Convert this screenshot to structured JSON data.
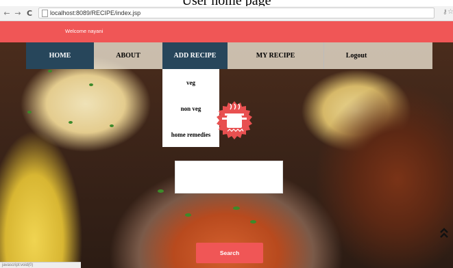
{
  "caption": "User home page",
  "browser": {
    "url": "localhost:8089/RECIPE/index.jsp",
    "status_text": "javascript:void(0)"
  },
  "welcome_text": "Welcome nayani",
  "menu": {
    "items": [
      "HOME",
      "ABOUT",
      "ADD RECIPE",
      "MY RECIPE",
      "Logout"
    ]
  },
  "dropdown": {
    "items": [
      "veg",
      "non veg",
      "home remedies"
    ]
  },
  "search": {
    "button_label": "Search"
  },
  "colors": {
    "accent": "#f05656",
    "nav_dark": "#27465b"
  },
  "icons": {
    "back": "back-arrow-icon",
    "forward": "forward-arrow-icon",
    "reload": "reload-icon",
    "page": "page-icon",
    "key": "key-icon",
    "bookmark": "star-icon",
    "logo": "cooking-pot-logo-icon",
    "scroll_top": "double-chevron-up-icon"
  }
}
